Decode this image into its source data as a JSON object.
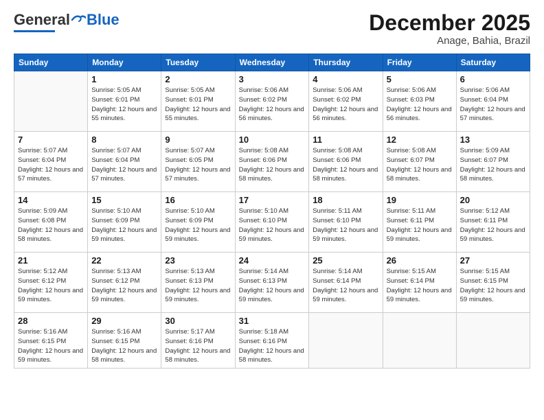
{
  "logo": {
    "general": "General",
    "blue": "Blue"
  },
  "header": {
    "month": "December 2025",
    "location": "Anage, Bahia, Brazil"
  },
  "days_of_week": [
    "Sunday",
    "Monday",
    "Tuesday",
    "Wednesday",
    "Thursday",
    "Friday",
    "Saturday"
  ],
  "weeks": [
    [
      {
        "day": "",
        "sunrise": "",
        "sunset": "",
        "daylight": ""
      },
      {
        "day": "1",
        "sunrise": "Sunrise: 5:05 AM",
        "sunset": "Sunset: 6:01 PM",
        "daylight": "Daylight: 12 hours and 55 minutes."
      },
      {
        "day": "2",
        "sunrise": "Sunrise: 5:05 AM",
        "sunset": "Sunset: 6:01 PM",
        "daylight": "Daylight: 12 hours and 55 minutes."
      },
      {
        "day": "3",
        "sunrise": "Sunrise: 5:06 AM",
        "sunset": "Sunset: 6:02 PM",
        "daylight": "Daylight: 12 hours and 56 minutes."
      },
      {
        "day": "4",
        "sunrise": "Sunrise: 5:06 AM",
        "sunset": "Sunset: 6:02 PM",
        "daylight": "Daylight: 12 hours and 56 minutes."
      },
      {
        "day": "5",
        "sunrise": "Sunrise: 5:06 AM",
        "sunset": "Sunset: 6:03 PM",
        "daylight": "Daylight: 12 hours and 56 minutes."
      },
      {
        "day": "6",
        "sunrise": "Sunrise: 5:06 AM",
        "sunset": "Sunset: 6:04 PM",
        "daylight": "Daylight: 12 hours and 57 minutes."
      }
    ],
    [
      {
        "day": "7",
        "sunrise": "Sunrise: 5:07 AM",
        "sunset": "Sunset: 6:04 PM",
        "daylight": "Daylight: 12 hours and 57 minutes."
      },
      {
        "day": "8",
        "sunrise": "Sunrise: 5:07 AM",
        "sunset": "Sunset: 6:04 PM",
        "daylight": "Daylight: 12 hours and 57 minutes."
      },
      {
        "day": "9",
        "sunrise": "Sunrise: 5:07 AM",
        "sunset": "Sunset: 6:05 PM",
        "daylight": "Daylight: 12 hours and 57 minutes."
      },
      {
        "day": "10",
        "sunrise": "Sunrise: 5:08 AM",
        "sunset": "Sunset: 6:06 PM",
        "daylight": "Daylight: 12 hours and 58 minutes."
      },
      {
        "day": "11",
        "sunrise": "Sunrise: 5:08 AM",
        "sunset": "Sunset: 6:06 PM",
        "daylight": "Daylight: 12 hours and 58 minutes."
      },
      {
        "day": "12",
        "sunrise": "Sunrise: 5:08 AM",
        "sunset": "Sunset: 6:07 PM",
        "daylight": "Daylight: 12 hours and 58 minutes."
      },
      {
        "day": "13",
        "sunrise": "Sunrise: 5:09 AM",
        "sunset": "Sunset: 6:07 PM",
        "daylight": "Daylight: 12 hours and 58 minutes."
      }
    ],
    [
      {
        "day": "14",
        "sunrise": "Sunrise: 5:09 AM",
        "sunset": "Sunset: 6:08 PM",
        "daylight": "Daylight: 12 hours and 58 minutes."
      },
      {
        "day": "15",
        "sunrise": "Sunrise: 5:10 AM",
        "sunset": "Sunset: 6:09 PM",
        "daylight": "Daylight: 12 hours and 59 minutes."
      },
      {
        "day": "16",
        "sunrise": "Sunrise: 5:10 AM",
        "sunset": "Sunset: 6:09 PM",
        "daylight": "Daylight: 12 hours and 59 minutes."
      },
      {
        "day": "17",
        "sunrise": "Sunrise: 5:10 AM",
        "sunset": "Sunset: 6:10 PM",
        "daylight": "Daylight: 12 hours and 59 minutes."
      },
      {
        "day": "18",
        "sunrise": "Sunrise: 5:11 AM",
        "sunset": "Sunset: 6:10 PM",
        "daylight": "Daylight: 12 hours and 59 minutes."
      },
      {
        "day": "19",
        "sunrise": "Sunrise: 5:11 AM",
        "sunset": "Sunset: 6:11 PM",
        "daylight": "Daylight: 12 hours and 59 minutes."
      },
      {
        "day": "20",
        "sunrise": "Sunrise: 5:12 AM",
        "sunset": "Sunset: 6:11 PM",
        "daylight": "Daylight: 12 hours and 59 minutes."
      }
    ],
    [
      {
        "day": "21",
        "sunrise": "Sunrise: 5:12 AM",
        "sunset": "Sunset: 6:12 PM",
        "daylight": "Daylight: 12 hours and 59 minutes."
      },
      {
        "day": "22",
        "sunrise": "Sunrise: 5:13 AM",
        "sunset": "Sunset: 6:12 PM",
        "daylight": "Daylight: 12 hours and 59 minutes."
      },
      {
        "day": "23",
        "sunrise": "Sunrise: 5:13 AM",
        "sunset": "Sunset: 6:13 PM",
        "daylight": "Daylight: 12 hours and 59 minutes."
      },
      {
        "day": "24",
        "sunrise": "Sunrise: 5:14 AM",
        "sunset": "Sunset: 6:13 PM",
        "daylight": "Daylight: 12 hours and 59 minutes."
      },
      {
        "day": "25",
        "sunrise": "Sunrise: 5:14 AM",
        "sunset": "Sunset: 6:14 PM",
        "daylight": "Daylight: 12 hours and 59 minutes."
      },
      {
        "day": "26",
        "sunrise": "Sunrise: 5:15 AM",
        "sunset": "Sunset: 6:14 PM",
        "daylight": "Daylight: 12 hours and 59 minutes."
      },
      {
        "day": "27",
        "sunrise": "Sunrise: 5:15 AM",
        "sunset": "Sunset: 6:15 PM",
        "daylight": "Daylight: 12 hours and 59 minutes."
      }
    ],
    [
      {
        "day": "28",
        "sunrise": "Sunrise: 5:16 AM",
        "sunset": "Sunset: 6:15 PM",
        "daylight": "Daylight: 12 hours and 59 minutes."
      },
      {
        "day": "29",
        "sunrise": "Sunrise: 5:16 AM",
        "sunset": "Sunset: 6:15 PM",
        "daylight": "Daylight: 12 hours and 58 minutes."
      },
      {
        "day": "30",
        "sunrise": "Sunrise: 5:17 AM",
        "sunset": "Sunset: 6:16 PM",
        "daylight": "Daylight: 12 hours and 58 minutes."
      },
      {
        "day": "31",
        "sunrise": "Sunrise: 5:18 AM",
        "sunset": "Sunset: 6:16 PM",
        "daylight": "Daylight: 12 hours and 58 minutes."
      },
      {
        "day": "",
        "sunrise": "",
        "sunset": "",
        "daylight": ""
      },
      {
        "day": "",
        "sunrise": "",
        "sunset": "",
        "daylight": ""
      },
      {
        "day": "",
        "sunrise": "",
        "sunset": "",
        "daylight": ""
      }
    ]
  ]
}
